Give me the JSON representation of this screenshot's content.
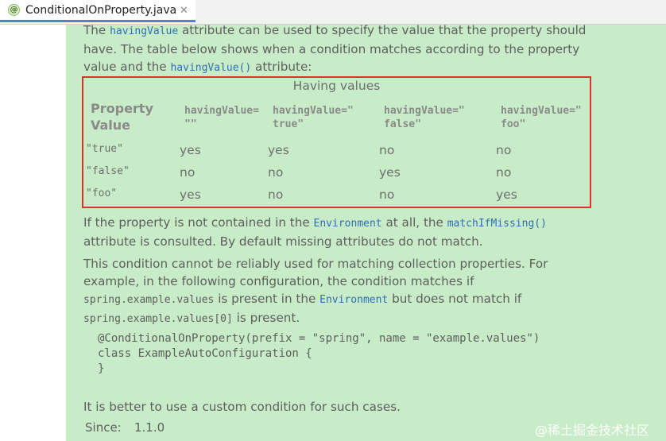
{
  "tab": {
    "icon": "@",
    "title": "ConditionalOnProperty.java",
    "close": "✕"
  },
  "doc": {
    "p1": {
      "t1": "The ",
      "c1": "havingValue",
      "t2": " attribute can be used to specify the value that the property should have. The table below shows when a condition matches according to the property value and the ",
      "c2": "havingValue()",
      "t3": " attribute:"
    },
    "table": {
      "caption": "Having values",
      "header_property": "Property Value",
      "headers": [
        "havingValue=\n\"\"",
        "havingValue=\"\ntrue\"",
        "havingValue=\"\nfalse\"",
        "havingValue=\"\nfoo\""
      ],
      "rows": [
        {
          "label": "\"true\"",
          "cells": [
            "yes",
            "yes",
            "no",
            "no"
          ]
        },
        {
          "label": "\"false\"",
          "cells": [
            "no",
            "no",
            "yes",
            "no"
          ]
        },
        {
          "label": "\"foo\"",
          "cells": [
            "yes",
            "no",
            "no",
            "yes"
          ]
        }
      ]
    },
    "p2": {
      "t1": "If the property is not contained in the ",
      "c1": "Environment",
      "t2": " at all, the ",
      "c2": "matchIfMissing()",
      "t3": " attribute is consulted. By default missing attributes do not match."
    },
    "p3": {
      "t1": "This condition cannot be reliably used for matching collection properties. For example, in the following configuration, the condition matches if ",
      "c1": "spring.example.values",
      "t2": " is present in the ",
      "c2": "Environment",
      "t3": " but does not match if ",
      "c3": "spring.example.values[0]",
      "t4": " is present."
    },
    "code": "@ConditionalOnProperty(prefix = \"spring\", name = \"example.values\")\nclass ExampleAutoConfiguration {\n}",
    "p4": "It is better to use a custom condition for such cases.",
    "since_label": "Since:",
    "since_value": "1.1.0"
  },
  "watermark": "@稀土掘金技术社区"
}
